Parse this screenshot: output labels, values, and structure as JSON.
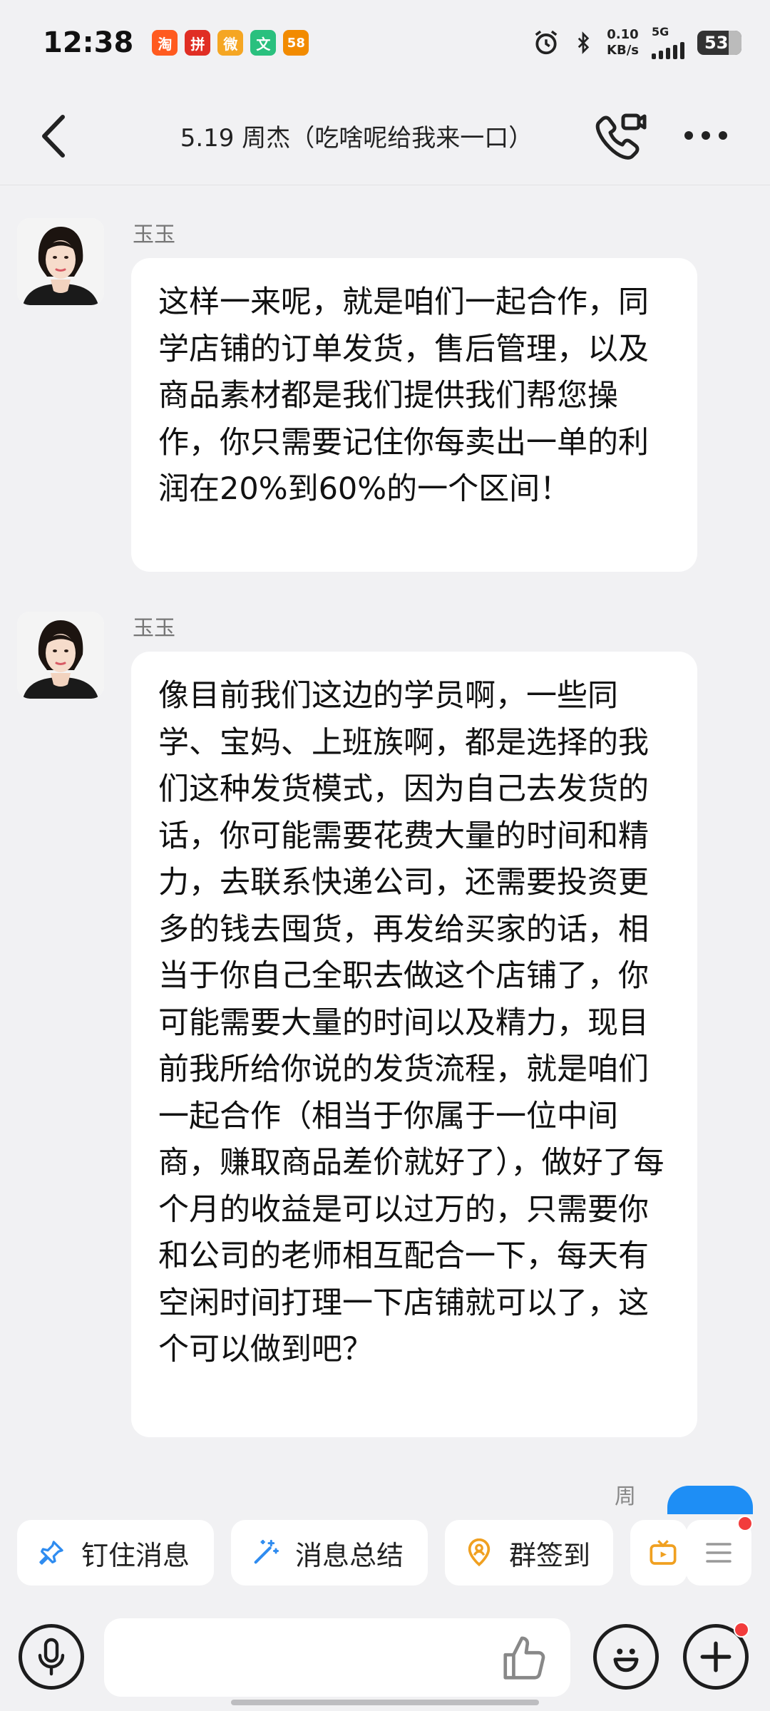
{
  "status_bar": {
    "time": "12:38",
    "net_speed_value": "0.10",
    "net_speed_unit": "KB/s",
    "network_type": "5G",
    "battery": "53",
    "apps": [
      {
        "name": "taobao-icon",
        "glyph": "淘",
        "color": "#ff5a1f"
      },
      {
        "name": "pinduoduo-icon",
        "glyph": "拼",
        "color": "#e02e24"
      },
      {
        "name": "weibo-icon",
        "glyph": "微",
        "color": "#f5a623"
      },
      {
        "name": "wenku-icon",
        "glyph": "文",
        "color": "#2ac07e"
      },
      {
        "name": "58-icon",
        "glyph": "58",
        "color": "#f28b00"
      }
    ]
  },
  "header": {
    "title": "5.19 周杰（吃啥呢给我来一口）"
  },
  "messages": [
    {
      "sender": "玉玉",
      "text": "这样一来呢，就是咱们一起合作，同学店铺的订单发货，售后管理，以及商品素材都是我们提供我们帮您操作，你只需要记住你每卖出一单的利润在20%到60%的一个区间！"
    },
    {
      "sender": "玉玉",
      "text": "像目前我们这边的学员啊，一些同学、宝妈、上班族啊，都是选择的我们这种发货模式，因为自己去发货的话，你可能需要花费大量的时间和精力，去联系快递公司，还需要投资更多的钱去囤货，再发给买家的话，相当于你自己全职去做这个店铺了，你可能需要大量的时间以及精力，现目前我所给你说的发货流程，就是咱们一起合作（相当于你属于一位中间商，赚取商品差价就好了），做好了每个月的收益是可以过万的，只需要你和公司的老师相互配合一下，每天有空闲时间打理一下店铺就可以了，这个可以做到吧？"
    }
  ],
  "next_sender_peek": "周",
  "quick_actions": [
    {
      "label": "钉住消息",
      "icon": "pin-icon"
    },
    {
      "label": "消息总结",
      "icon": "magic-wand-icon"
    },
    {
      "label": "群签到",
      "icon": "location-person-icon"
    }
  ],
  "input": {
    "placeholder": ""
  },
  "colors": {
    "accent": "#1e8ef5",
    "background": "#f1f1f3",
    "bubble": "#ffffff",
    "badge": "#f23c3c",
    "pin": "#2f8cf0",
    "checkin": "#f0a020"
  }
}
